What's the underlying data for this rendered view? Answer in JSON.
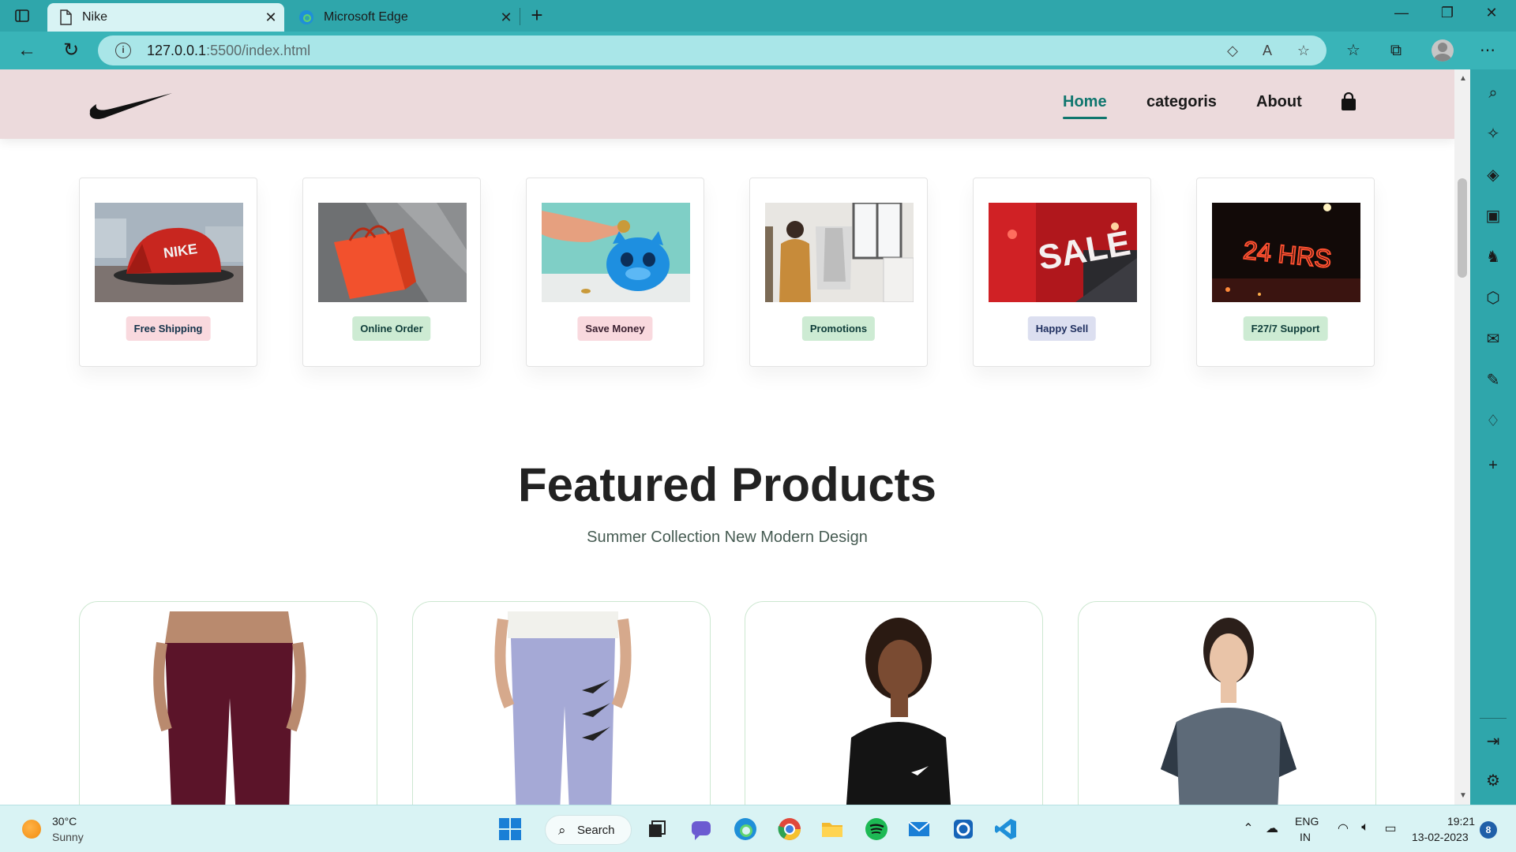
{
  "browser": {
    "tabs": [
      {
        "title": "Nike"
      },
      {
        "title": "Microsoft Edge"
      }
    ],
    "url": {
      "host": "127.0.0.1",
      "path": ":5500/index.html"
    }
  },
  "site": {
    "nav": {
      "home": "Home",
      "categories": "categoris",
      "about": "About"
    },
    "features": [
      {
        "label": "Free Shipping",
        "badge_bg": "#f9d9de",
        "badge_fg": "#12324a"
      },
      {
        "label": "Online Order",
        "badge_bg": "#cdebd3",
        "badge_fg": "#0f3d3a"
      },
      {
        "label": "Save Money",
        "badge_bg": "#f9d9de",
        "badge_fg": "#3a2030"
      },
      {
        "label": "Promotions",
        "badge_bg": "#cdebd3",
        "badge_fg": "#0f3d3a"
      },
      {
        "label": "Happy Sell",
        "badge_bg": "#dcdff0",
        "badge_fg": "#1f2f5f"
      },
      {
        "label": "F27/7 Support",
        "badge_bg": "#cdebd3",
        "badge_fg": "#0f3d3a"
      }
    ],
    "featured": {
      "title": "Featured Products",
      "subtitle": "Summer Collection New Modern Design"
    }
  },
  "taskbar": {
    "weather": {
      "temp": "30°C",
      "desc": "Sunny"
    },
    "search_label": "Search",
    "lang": {
      "line1": "ENG",
      "line2": "IN"
    },
    "clock": {
      "time": "19:21",
      "date": "13-02-2023"
    },
    "notifications": "8"
  },
  "colors": {
    "accent": "#0f766e",
    "header_bg": "#ecdadc",
    "chrome": "#2fa6ab"
  }
}
